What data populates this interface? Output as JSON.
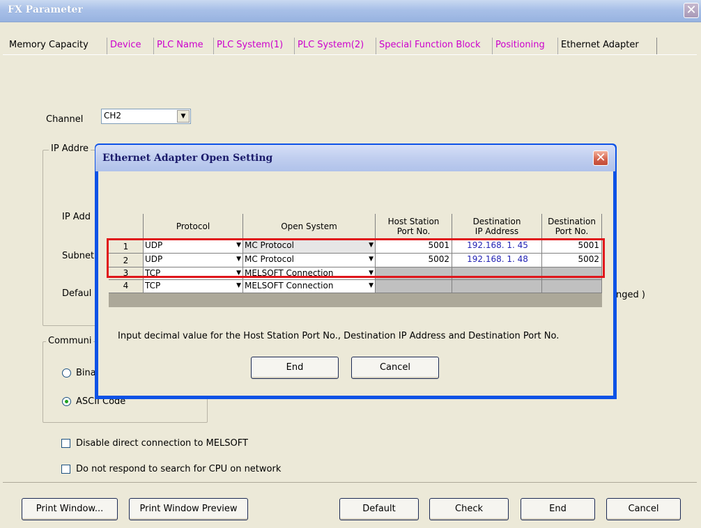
{
  "window": {
    "title": "FX Parameter",
    "close_glyph": "✕"
  },
  "tabs": [
    "Memory Capacity",
    "Device",
    "PLC Name",
    "PLC System(1)",
    "PLC System(2)",
    "Special Function Block",
    "Positioning",
    "Ethernet Adapter"
  ],
  "active_tab": "Ethernet Adapter",
  "main": {
    "channel_label": "Channel",
    "channel_value": "CH2",
    "ip_group_label": "IP Addre",
    "ip_addr_label": "IP Add",
    "subnet_label": "Subnet",
    "default_label": "Defaul",
    "changed_note": "nged )",
    "comm_group_label": "Communi",
    "binary_label": "Bina",
    "ascii_label": "ASCII Code",
    "ascii_selected": true,
    "disable_direct_label": "Disable direct connection to MELSOFT",
    "no_respond_label": "Do not respond to search for CPU on network"
  },
  "footer": {
    "print_window": "Print Window...",
    "print_preview": "Print Window Preview",
    "default": "Default",
    "check": "Check",
    "end": "End",
    "cancel": "Cancel"
  },
  "dialog": {
    "title": "Ethernet Adapter  Open Setting",
    "close_glyph": "✕",
    "columns": {
      "protocol": "Protocol",
      "open_system": "Open System",
      "host_port_1": "Host Station",
      "host_port_2": "Port No.",
      "dest_ip_1": "Destination",
      "dest_ip_2": "IP Address",
      "dest_port_1": "Destination",
      "dest_port_2": "Port No."
    },
    "rows": [
      {
        "num": "1",
        "protocol": "UDP",
        "open_system": "MC Protocol",
        "host_port": "5001",
        "dest_ip": "192.168.  1. 45",
        "dest_port": "5001"
      },
      {
        "num": "2",
        "protocol": "UDP",
        "open_system": "MC Protocol",
        "host_port": "5002",
        "dest_ip": "192.168.  1. 48",
        "dest_port": "5002"
      },
      {
        "num": "3",
        "protocol": "TCP",
        "open_system": "MELSOFT Connection",
        "host_port": "",
        "dest_ip": "",
        "dest_port": ""
      },
      {
        "num": "4",
        "protocol": "TCP",
        "open_system": "MELSOFT Connection",
        "host_port": "",
        "dest_ip": "",
        "dest_port": ""
      }
    ],
    "note": "Input decimal value for the Host Station Port No., Destination IP Address and Destination Port No.",
    "end_button": "End",
    "cancel_button": "Cancel"
  },
  "colors": {
    "highlight": "#e0161b",
    "tab_link": "#cc00cc",
    "ip_text": "#2323b4",
    "dialog_frame": "#0d52e6"
  }
}
